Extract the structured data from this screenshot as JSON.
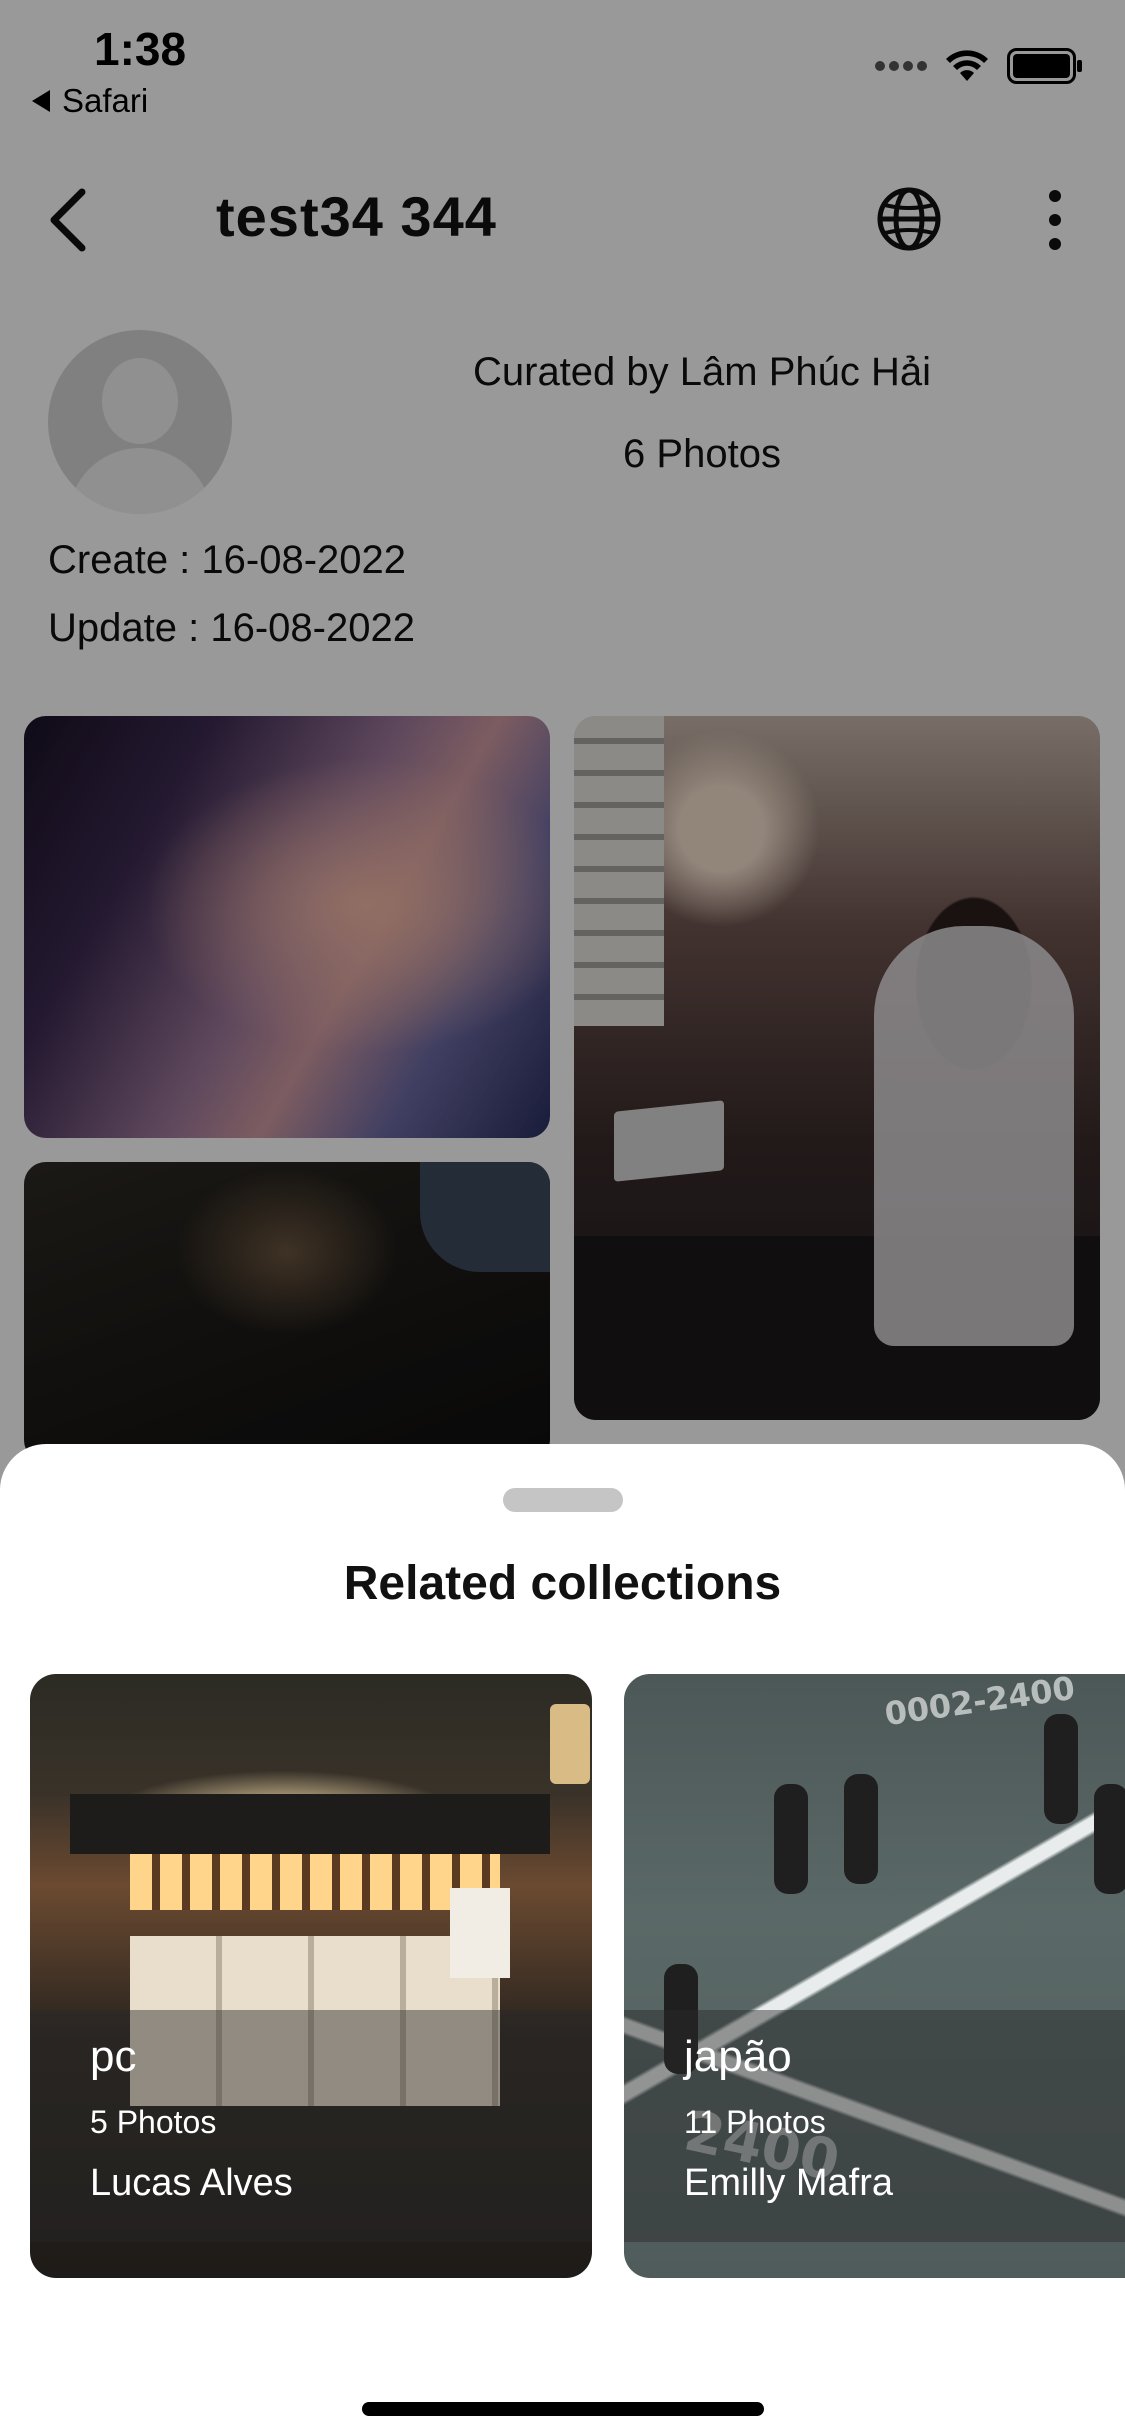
{
  "status_bar": {
    "time": "1:38",
    "back_app": "Safari",
    "icons": [
      "signal-icon",
      "wifi-icon",
      "battery-icon"
    ]
  },
  "nav": {
    "title": "test34 344",
    "icons": [
      "back-chevron-icon",
      "globe-icon",
      "more-vertical-icon"
    ]
  },
  "collection": {
    "curated_by": "Curated by Lâm Phúc Hải",
    "photos": "6 Photos",
    "created": "Create : 16-08-2022",
    "updated": "Update : 16-08-2022"
  },
  "sheet": {
    "title": "Related collections",
    "cards": [
      {
        "name": "pc",
        "photos": "5 Photos",
        "author": "Lucas Alves"
      },
      {
        "name": "japão",
        "photos": "11 Photos",
        "author": "Emilly Mafra"
      }
    ]
  },
  "colors": {
    "overlay": "#000000",
    "sheet_bg": "#ffffff",
    "text": "#111111"
  }
}
